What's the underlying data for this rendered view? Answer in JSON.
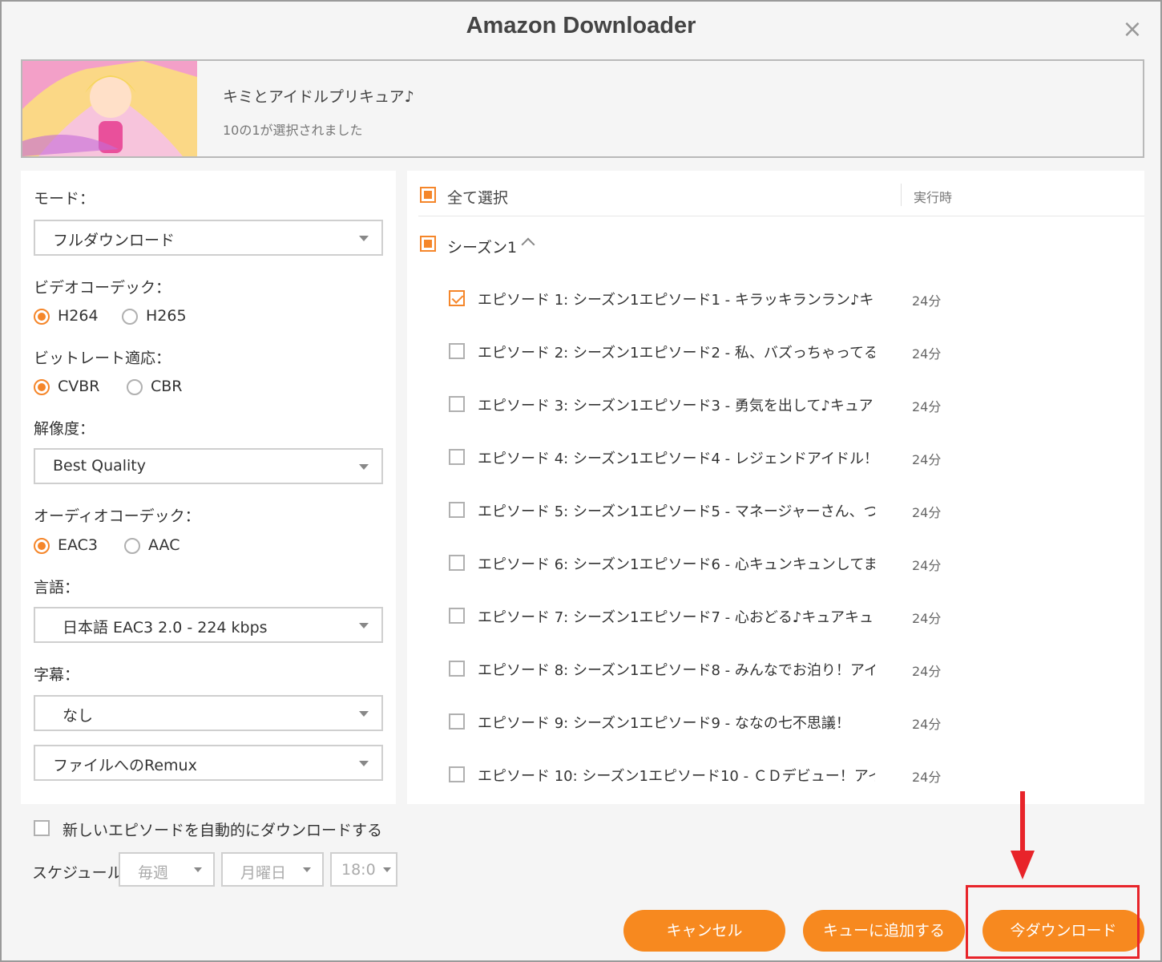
{
  "window": {
    "title": "Amazon Downloader",
    "close_icon": "close-icon"
  },
  "show": {
    "title": "キミとアイドルプリキュア♪",
    "selection_status": "10の1が選択されました"
  },
  "settings": {
    "mode_label": "モード：",
    "mode_value": "フルダウンロード",
    "video_codec_label": "ビデオコーデック：",
    "video_codec_options": [
      "H264",
      "H265"
    ],
    "bitrate_label": "ビットレート適応：",
    "bitrate_options": [
      "CVBR",
      "CBR"
    ],
    "resolution_label": "解像度：",
    "resolution_value": "Best Quality",
    "audio_codec_label": "オーディオコーデック：",
    "audio_codec_options": [
      "EAC3",
      "AAC"
    ],
    "language_label": "言語：",
    "language_value": "日本語 EAC3 2.0 - 224 kbps",
    "subtitle_label": "字幕：",
    "subtitle_value": "なし",
    "remux_value": "ファイルへのRemux"
  },
  "episodes": {
    "select_all_label": "全て選択",
    "runtime_header": "実行時",
    "season_label": "シーズン1",
    "items": [
      {
        "title": "エピソード 1: シーズン1エピソード1 - キラッキランラン♪キュアアイドルデビュー！",
        "duration": "24分",
        "checked": true
      },
      {
        "title": "エピソード 2: シーズン1エピソード2 - 私、バズっちゃってる！？",
        "duration": "24分",
        "checked": false
      },
      {
        "title": "エピソード 3: シーズン1エピソード3 - 勇気を出して♪キュアウインク誕生！",
        "duration": "24分",
        "checked": false
      },
      {
        "title": "エピソード 4: シーズン1エピソード4 - レジェンドアイドル！？響カイト",
        "duration": "24分",
        "checked": false
      },
      {
        "title": "エピソード 5: シーズン1エピソード5 - マネージャーさん、ついちゃった！？",
        "duration": "24分",
        "checked": false
      },
      {
        "title": "エピソード 6: シーズン1エピソード6 - 心キュンキュンしてます！？",
        "duration": "24分",
        "checked": false
      },
      {
        "title": "エピソード 7: シーズン1エピソード7 - 心おどる♪キュアキュンキュン誕生！",
        "duration": "24分",
        "checked": false
      },
      {
        "title": "エピソード 8: シーズン1エピソード8 - みんなでお泊り！アイドル合宿",
        "duration": "24分",
        "checked": false
      },
      {
        "title": "エピソード 9: シーズン1エピソード9 - ななの七不思議！",
        "duration": "24分",
        "checked": false
      },
      {
        "title": "エピソード 10: シーズン1エピソード10 - ＣＤデビュー！アイドルプリキュア",
        "duration": "24分",
        "checked": false
      }
    ]
  },
  "auto_download": {
    "label": "新しいエピソードを自動的にダウンロードする",
    "checked": false
  },
  "schedule": {
    "label": "スケジュール:",
    "frequency": "毎週",
    "day": "月曜日",
    "time": "18:0"
  },
  "buttons": {
    "cancel": "キャンセル",
    "add_queue": "キューに追加する",
    "download_now": "今ダウンロード"
  },
  "colors": {
    "accent": "#f7891f",
    "annotation": "#e8242a"
  }
}
